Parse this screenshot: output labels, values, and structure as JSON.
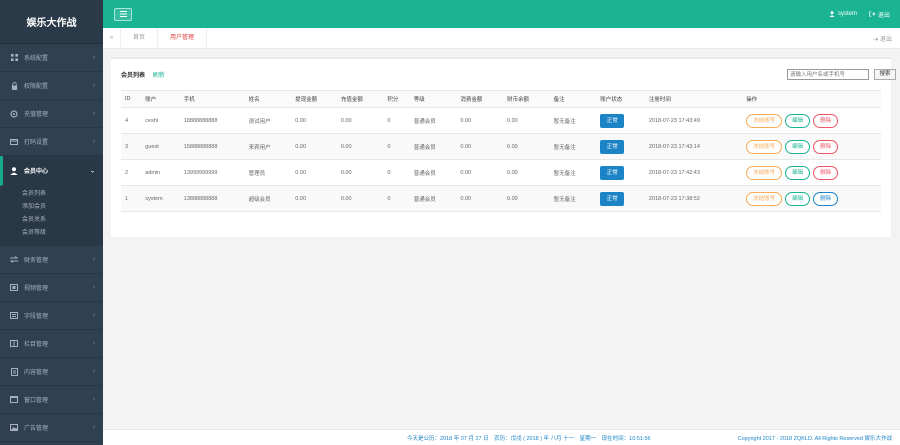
{
  "brand": "娱乐大作战",
  "sidebar": {
    "items": [
      {
        "label": "系统配置",
        "icon": "grid-icon"
      },
      {
        "label": "权限配置",
        "icon": "lock-icon"
      },
      {
        "label": "充值管理",
        "icon": "gear-icon"
      },
      {
        "label": "打码设置",
        "icon": "card-icon"
      },
      {
        "label": "会员中心",
        "icon": "user-icon"
      },
      {
        "label": "财务管理",
        "icon": "exchange-icon"
      },
      {
        "label": "视频管理",
        "icon": "film-icon"
      },
      {
        "label": "字段管理",
        "icon": "list-icon"
      },
      {
        "label": "栏目管理",
        "icon": "columns-icon"
      },
      {
        "label": "内容管理",
        "icon": "doc-icon"
      },
      {
        "label": "窗口管理",
        "icon": "window-icon"
      },
      {
        "label": "广告管理",
        "icon": "image-icon"
      }
    ],
    "subitems": [
      "会员列表",
      "添加会员",
      "会员关系",
      "会员等级"
    ]
  },
  "topbar": {
    "user": "system",
    "logout": "退出"
  },
  "tabs": {
    "home": "首页",
    "current": "用户管理",
    "exit": "退出"
  },
  "panel": {
    "title": "会员列表",
    "refresh": "刷新",
    "search_placeholder": "请输入用户名或手机号",
    "search_button": "搜索"
  },
  "table": {
    "headers": [
      "ID",
      "账户",
      "手机",
      "姓名",
      "提现金额",
      "充值金额",
      "积分",
      "等级",
      "消费金额",
      "财币余额",
      "备注",
      "账户状态",
      "注册时间",
      "操作"
    ],
    "rows": [
      {
        "id": "4",
        "account": "ceshi",
        "phone": "18888888888",
        "name": "测试用户",
        "withdraw": "0.00",
        "recharge": "0.00",
        "points": "0",
        "level": "普通会员",
        "consume": "0.00",
        "balance": "0.00",
        "remark": "暂无备注",
        "status": "正常",
        "time": "2018-07-23 17:43:49",
        "lock": "冻结账号",
        "edit": "编辑",
        "del": "删除"
      },
      {
        "id": "3",
        "account": "guest",
        "phone": "15888888888",
        "name": "来宾用户",
        "withdraw": "0.00",
        "recharge": "0.00",
        "points": "0",
        "level": "普通会员",
        "consume": "0.00",
        "balance": "0.00",
        "remark": "暂无备注",
        "status": "正常",
        "time": "2018-07-23 17:43:14",
        "lock": "冻结账号",
        "edit": "编辑",
        "del": "删除"
      },
      {
        "id": "2",
        "account": "admin",
        "phone": "13999999999",
        "name": "管理员",
        "withdraw": "0.00",
        "recharge": "0.00",
        "points": "0",
        "level": "普通会员",
        "consume": "0.00",
        "balance": "0.00",
        "remark": "暂无备注",
        "status": "正常",
        "time": "2018-07-23 17:42:43",
        "lock": "冻结账号",
        "edit": "编辑",
        "del": "删除"
      },
      {
        "id": "1",
        "account": "system",
        "phone": "13888888888",
        "name": "超级会员",
        "withdraw": "0.00",
        "recharge": "0.00",
        "points": "0",
        "level": "普通会员",
        "consume": "0.00",
        "balance": "0.00",
        "remark": "暂无备注",
        "status": "正常",
        "time": "2018-07-23 17:38:52",
        "lock": "冻结账号",
        "edit": "编辑",
        "del": "删除"
      }
    ]
  },
  "footer": {
    "today": "今天是公历：2018 年 07 月 27 日　农历：戊戌 ( 2018 ) 年 八月 十一　星期一　现在时间：10:51:56",
    "copyright": "Copyright 2017 - 2018 ZQKLD. All Rights Reserved 娱乐大作战"
  },
  "colors": {
    "accent": "#1ab394",
    "sidebar": "#2f4050",
    "primary": "#1c84c6",
    "danger": "#ed5565",
    "warning": "#f8ac59"
  }
}
